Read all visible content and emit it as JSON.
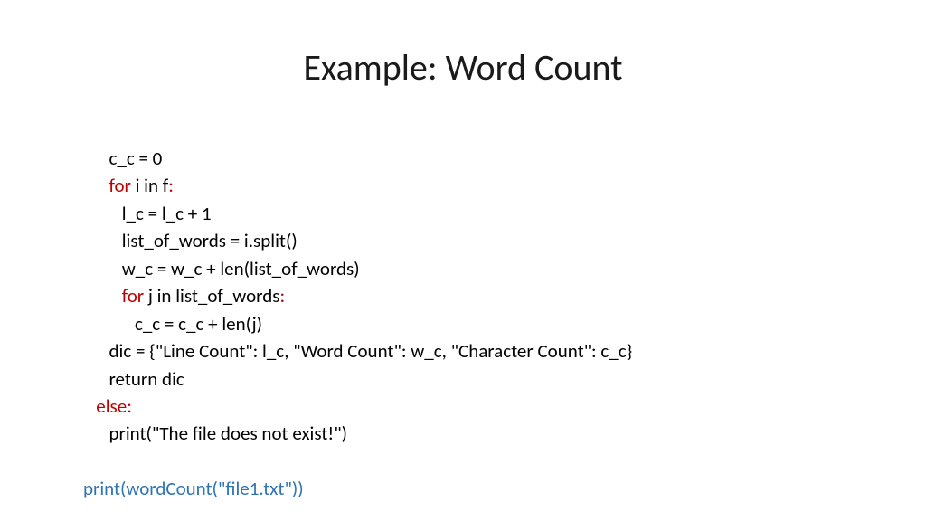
{
  "title": "Example: Word Count",
  "code": {
    "l1_a": "      c_c = 0",
    "l2_kw1": "      for",
    "l2_mid": " i in f",
    "l2_colon": ":",
    "l3": "         l_c = l_c + 1",
    "l4": "         list_of_words = i.split()",
    "l5": "         w_c = w_c + len(list_of_words)",
    "l6_kw1": "         for",
    "l6_mid": " j in list_of_words",
    "l6_colon": ":",
    "l7": "            c_c = c_c + len(j)",
    "l8": "      dic = {\"Line Count\": l_c, \"Word Count\": w_c, \"Character Count\": c_c}",
    "l9": "      return dic",
    "l10_kw": "   else",
    "l10_colon": ":",
    "l11": "      print(\"The file does not exist!\")",
    "blank": "",
    "l12": "print(wordCount(\"file1.txt\"))"
  }
}
